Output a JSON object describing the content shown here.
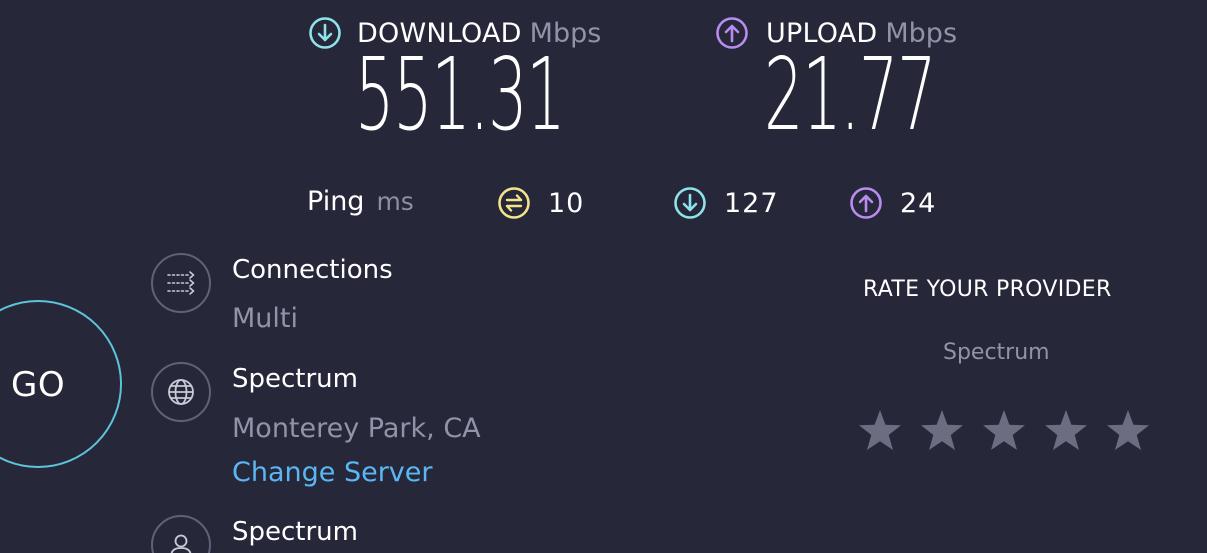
{
  "download": {
    "label": "DOWNLOAD",
    "unit": "Mbps",
    "value": "551.31",
    "icon": "arrow-down-circle-icon",
    "color": "#8ee3ea"
  },
  "upload": {
    "label": "UPLOAD",
    "unit": "Mbps",
    "value": "21.77",
    "icon": "arrow-up-circle-icon",
    "color": "#b98cf0"
  },
  "ping": {
    "label": "Ping",
    "unit": "ms",
    "idle": {
      "value": "10",
      "icon": "ping-idle-icon",
      "color": "#f3e38a"
    },
    "download": {
      "value": "127",
      "icon": "arrow-down-circle-icon",
      "color": "#8ee3ea"
    },
    "upload": {
      "value": "24",
      "icon": "arrow-up-circle-icon",
      "color": "#b98cf0"
    }
  },
  "go_button": {
    "label": "GO",
    "ring_color": "#5ec3d8"
  },
  "connections": {
    "title": "Connections",
    "value": "Multi",
    "icon": "connections-icon"
  },
  "server": {
    "title": "Spectrum",
    "location": "Monterey Park, CA",
    "change_link": "Change Server",
    "icon": "globe-icon"
  },
  "provider": {
    "title": "Spectrum",
    "icon": "user-icon"
  },
  "rating": {
    "title": "RATE YOUR PROVIDER",
    "provider_name": "Spectrum",
    "stars": 5,
    "star_color": "#6b6d80"
  }
}
